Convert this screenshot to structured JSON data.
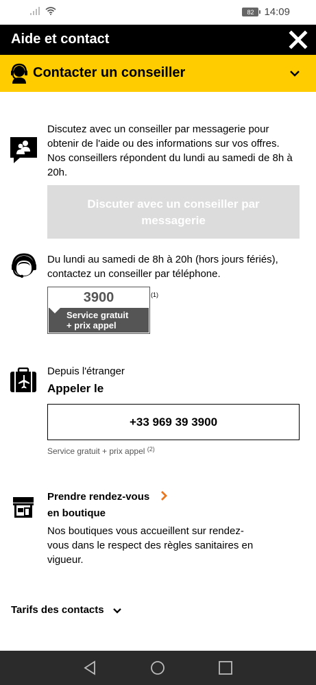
{
  "status_bar": {
    "battery": "82",
    "time": "14:09"
  },
  "header": {
    "title": "Aide et contact"
  },
  "accordion": {
    "title": "Contacter un conseiller"
  },
  "messaging": {
    "lines": [
      "Discutez avec un conseiller par messagerie pour",
      "obtenir de l'aide ou des informations sur vos offres.",
      "Nos conseillers répondent du lundi au samedi de 8h à",
      "20h."
    ],
    "button_line1": "Discuter avec un conseiller par",
    "button_line2": "messagerie"
  },
  "phone": {
    "line1": "Du lundi au samedi de 8h à 20h (hors jours fériés),",
    "line2": "contactez un conseiller par téléphone.",
    "number": "3900",
    "band_line1": "Service gratuit",
    "band_line2": "+ prix appel",
    "note": "(1)"
  },
  "abroad": {
    "label": "Depuis l'étranger",
    "title": "Appeler le",
    "number": "+33 969 39 3900",
    "note_text": "Service gratuit + prix appel",
    "note_ref": "(2)"
  },
  "shop": {
    "title_line1": "Prendre rendez-vous",
    "title_line2": "en boutique",
    "lines": [
      "Nos boutiques vous accueillent sur rendez-",
      "vous dans le respect des règles sanitaires en",
      "vigueur."
    ]
  },
  "tarifs": {
    "label": "Tarifs des contacts"
  },
  "colors": {
    "accent": "#ffcc00",
    "header": "#000000",
    "link_chevron": "#e87722",
    "disabled_button": "#dcdcdc"
  }
}
